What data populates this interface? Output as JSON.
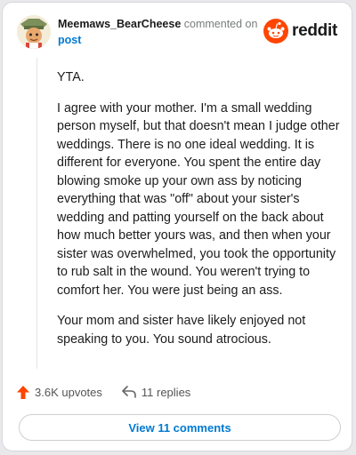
{
  "header": {
    "username": "Meemaws_BearCheese",
    "action": "commented on",
    "post_link": "post",
    "brand": "reddit",
    "brand_color": "#ff4500"
  },
  "comment": {
    "paragraphs": [
      "YTA.",
      "I agree with your mother. I'm a small wedding person myself, but that doesn't mean I judge other weddings. There is no one ideal wedding. It is different for everyone. You spent the entire day blowing smoke up your own ass by noticing everything that was \"off\" about your sister's wedding and patting yourself on the back about how much better yours was, and then when your sister was overwhelmed, you took the opportunity to rub salt in the wound. You weren't trying to comfort her. You were just being an ass.",
      "Your mom and sister have likely enjoyed not speaking to you. You sound atrocious."
    ]
  },
  "actions": {
    "upvotes": "3.6K upvotes",
    "replies": "11 replies",
    "upvote_color": "#ff4500"
  },
  "view_button": {
    "label": "View 11 comments",
    "color": "#0079d3"
  }
}
